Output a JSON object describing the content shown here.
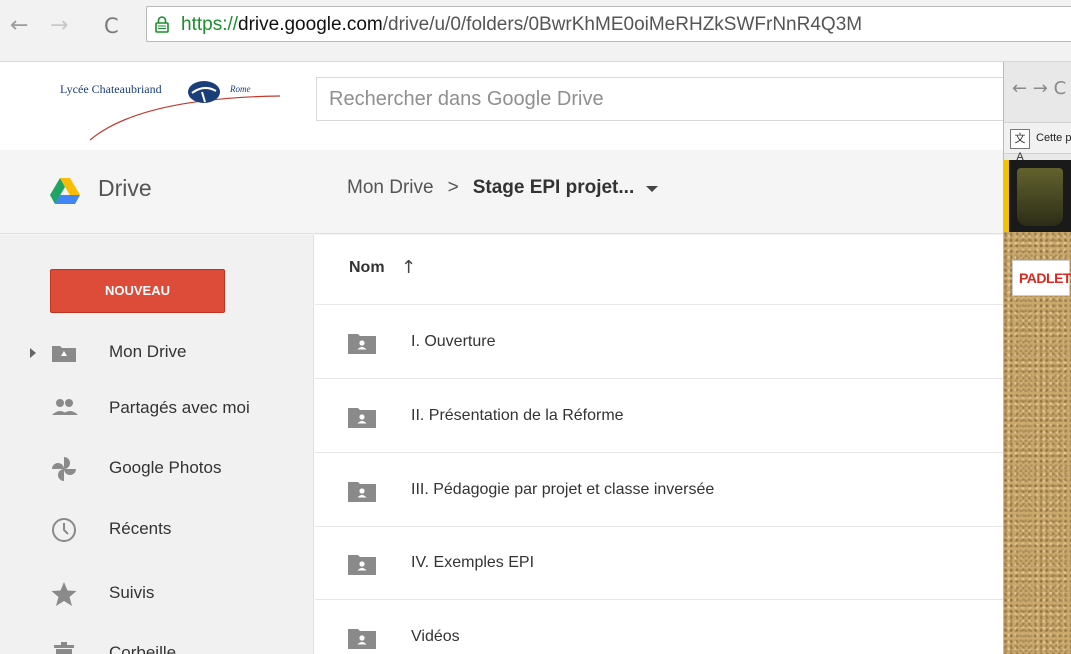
{
  "browser": {
    "url_scheme": "https://",
    "url_host": "drive.google.com",
    "url_path": "/drive/u/0/folders/0BwrKhME0oiMeRHZkSWFrNnR4Q3M"
  },
  "header": {
    "logo_text": "Lycée Chateaubriand",
    "logo_sub": "Rome",
    "search_placeholder": "Rechercher dans Google Drive"
  },
  "drive": {
    "title": "Drive",
    "breadcrumb": {
      "root": "Mon Drive",
      "separator": ">",
      "current": "Stage EPI projet..."
    }
  },
  "sidebar": {
    "new_button": "NOUVEAU",
    "items": [
      {
        "label": "Mon Drive",
        "icon": "drive-folder-icon"
      },
      {
        "label": "Partagés avec moi",
        "icon": "people-icon"
      },
      {
        "label": "Google Photos",
        "icon": "photos-pinwheel-icon"
      },
      {
        "label": "Récents",
        "icon": "clock-icon"
      },
      {
        "label": "Suivis",
        "icon": "star-icon"
      },
      {
        "label": "Corbeille",
        "icon": "trash-icon"
      }
    ]
  },
  "main": {
    "column_name": "Nom",
    "sort_glyph": "↑",
    "files": [
      {
        "name": "I. Ouverture",
        "icon": "shared-folder-icon"
      },
      {
        "name": "II. Présentation de la Réforme",
        "icon": "shared-folder-icon"
      },
      {
        "name": "III. Pédagogie par projet et classe inversée",
        "icon": "shared-folder-icon"
      },
      {
        "name": "IV. Exemples EPI",
        "icon": "shared-folder-icon"
      },
      {
        "name": "Vidéos",
        "icon": "shared-folder-icon"
      }
    ]
  },
  "overlay": {
    "nav": "← → C",
    "translate_icon": "文A",
    "translate_text": "Cette p",
    "badge": "PADLET"
  },
  "colors": {
    "new_button": "#dd4b39",
    "url_scheme": "#1a8f2c",
    "sidebar_bg": "#f1f1f1",
    "icon_grey": "#8a8a8a",
    "padlet_red": "#d9281f"
  }
}
